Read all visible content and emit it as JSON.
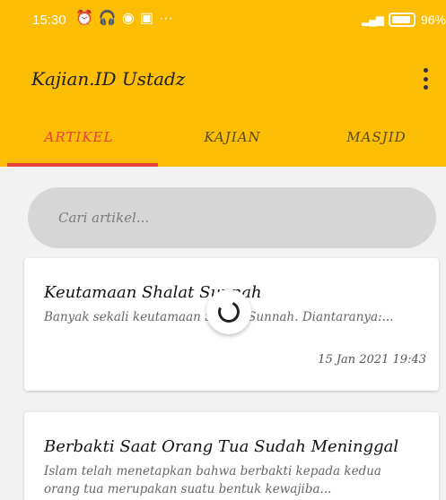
{
  "status_bar": {
    "time": "15:30",
    "icons": [
      "alarm-icon",
      "headphones-icon",
      "camera-icon",
      "gallery-icon",
      "more-dots-icon"
    ],
    "dots": "···",
    "battery_text": "96%"
  },
  "toolbar": {
    "title": "Kajian.ID Ustadz",
    "menu_icon": "more-vert-icon"
  },
  "tabs": [
    {
      "label": "ARTIKEL",
      "active": true
    },
    {
      "label": "KAJIAN",
      "active": false
    },
    {
      "label": "MASJID",
      "active": false
    }
  ],
  "search": {
    "placeholder": "Cari artikel..."
  },
  "articles": [
    {
      "title": "Keutamaan Shalat Sunnah",
      "excerpt": "Banyak sekali keutamaan Shalat Sunnah. Diantaranya:...",
      "date": "15 Jan 2021 19:43"
    },
    {
      "title": "Berbakti Saat Orang Tua Sudah Meninggal",
      "excerpt": "Islam telah menetapkan bahwa berbakti kepada kedua orang tua merupakan suatu bentuk kewajiba..."
    }
  ],
  "colors": {
    "primary": "#fcbe04",
    "accent": "#e8403a",
    "search_bg": "#d6d6d6",
    "background": "#f2f2f2"
  }
}
